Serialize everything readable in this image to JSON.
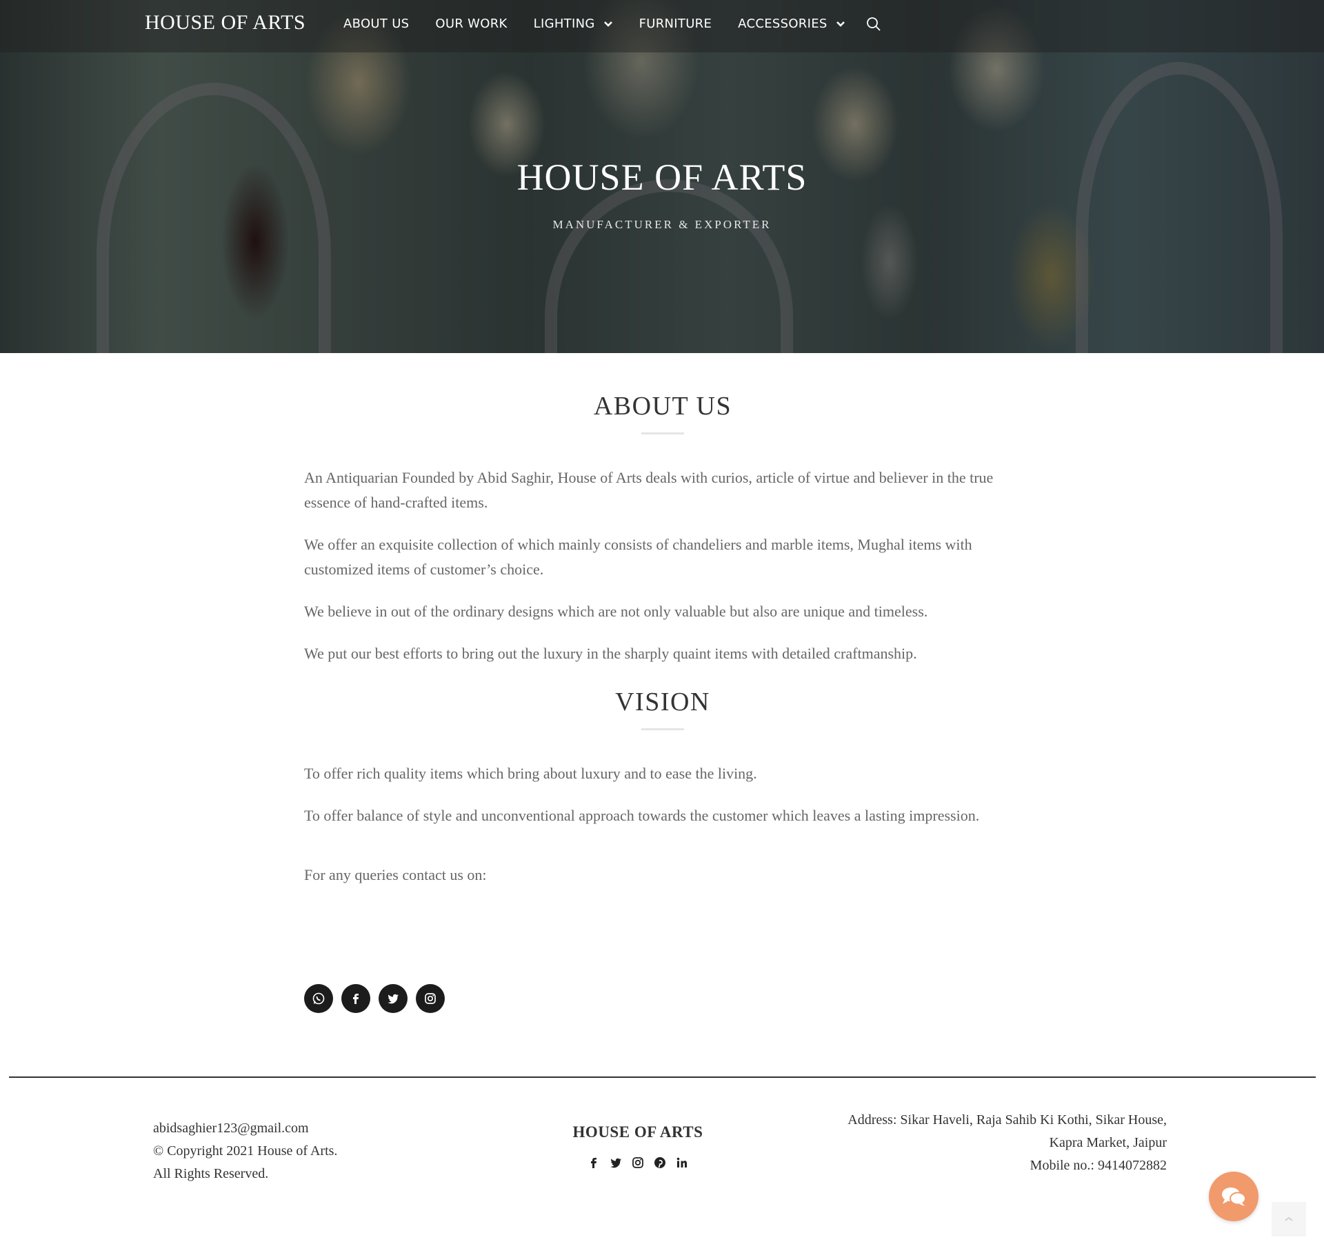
{
  "header": {
    "brand": "HOUSE OF ARTS",
    "nav": [
      {
        "label": "ABOUT US"
      },
      {
        "label": "OUR WORK"
      },
      {
        "label": "LIGHTING"
      },
      {
        "label": "FURNITURE"
      },
      {
        "label": "ACCESSORIES"
      }
    ],
    "search_icon": "search-icon"
  },
  "hero": {
    "title": "HOUSE OF ARTS",
    "subtitle": "MANUFACTURER & EXPORTER"
  },
  "about": {
    "heading": "ABOUT US",
    "paragraphs": [
      "An Antiquarian Founded by Abid Saghir, House of Arts deals with curios, article of virtue and believer in the true essence of hand-crafted items.",
      "We offer an exquisite collection of which mainly consists of chandeliers and marble items, Mughal items with customized items of customer’s choice.",
      "We believe in out of the ordinary designs which are not only valuable but also are unique and timeless.",
      "We put our best efforts to bring out the luxury in the sharply quaint items with detailed craftmanship."
    ]
  },
  "vision": {
    "heading": "VISION",
    "paragraphs": [
      "To offer rich quality items which bring about luxury and to ease the living.",
      "To offer balance of style and unconventional approach towards the customer which leaves a lasting impression."
    ],
    "contact_prompt": "For any queries contact us on:"
  },
  "social": [
    "whatsapp-icon",
    "facebook-icon",
    "twitter-icon",
    "instagram-icon"
  ],
  "footer": {
    "email": "abidsaghier123@gmail.com",
    "copyright": "© Copyright 2021 House of Arts.",
    "rights": "All Rights Reserved.",
    "brand": "HOUSE OF ARTS",
    "icons": [
      "facebook-icon",
      "twitter-icon",
      "instagram-icon",
      "pinterest-icon",
      "linkedin-icon"
    ],
    "address_line1": "Address: Sikar Haveli, Raja Sahib Ki Kothi, Sikar House,",
    "address_line2": "Kapra Market, Jaipur",
    "mobile": "Mobile no.: 9414072882"
  },
  "colors": {
    "chat_button": "#f19a6c",
    "social_button": "#1c1c1c"
  }
}
